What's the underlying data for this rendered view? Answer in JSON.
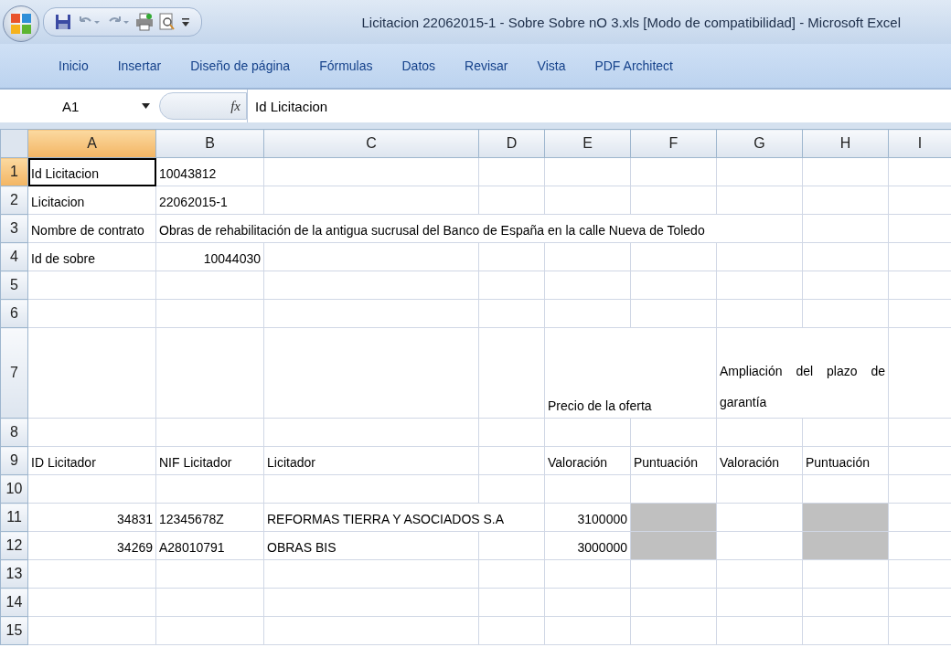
{
  "window": {
    "title": "Licitacion 22062015-1 - Sobre Sobre nO 3.xls  [Modo de compatibilidad] - Microsoft Excel"
  },
  "ribbon_tabs": [
    {
      "label": "Inicio"
    },
    {
      "label": "Insertar"
    },
    {
      "label": "Diseño de página"
    },
    {
      "label": "Fórmulas"
    },
    {
      "label": "Datos"
    },
    {
      "label": "Revisar"
    },
    {
      "label": "Vista"
    },
    {
      "label": "PDF Architect"
    }
  ],
  "formula_bar": {
    "name_box": "A1",
    "function_label": "fx",
    "formula": "Id Licitacion"
  },
  "sheet": {
    "columns": [
      {
        "label": "A",
        "selected": true
      },
      {
        "label": "B",
        "selected": false
      },
      {
        "label": "C",
        "selected": false
      },
      {
        "label": "D",
        "selected": false
      },
      {
        "label": "E",
        "selected": false
      },
      {
        "label": "F",
        "selected": false
      },
      {
        "label": "G",
        "selected": false
      },
      {
        "label": "H",
        "selected": false
      },
      {
        "label": "I",
        "selected": false
      }
    ],
    "rows": [
      {
        "number": "1",
        "selected": true,
        "cells": [
          {
            "kind": "text",
            "text": "Id Licitacion"
          },
          {
            "kind": "text",
            "text": "10043812"
          },
          {
            "kind": "empty"
          },
          {
            "kind": "empty"
          },
          {
            "kind": "empty"
          },
          {
            "kind": "empty"
          },
          {
            "kind": "empty"
          },
          {
            "kind": "empty"
          },
          {
            "kind": "empty"
          }
        ]
      },
      {
        "number": "2",
        "selected": false,
        "cells": [
          {
            "kind": "text",
            "text": "Licitacion"
          },
          {
            "kind": "text",
            "text": "22062015-1"
          },
          {
            "kind": "empty"
          },
          {
            "kind": "empty"
          },
          {
            "kind": "empty"
          },
          {
            "kind": "empty"
          },
          {
            "kind": "empty"
          },
          {
            "kind": "empty"
          },
          {
            "kind": "empty"
          }
        ]
      },
      {
        "number": "3",
        "selected": false,
        "cells": [
          {
            "kind": "text",
            "text": "Nombre de contrato"
          },
          {
            "kind": "text",
            "text": "Obras de rehabilitación de la antigua sucrusal del Banco de España en la calle Nueva de Toledo"
          },
          {
            "kind": "overflow"
          },
          {
            "kind": "overflow"
          },
          {
            "kind": "overflow"
          },
          {
            "kind": "overflow"
          },
          {
            "kind": "overflow"
          },
          {
            "kind": "empty"
          },
          {
            "kind": "empty"
          }
        ]
      },
      {
        "number": "4",
        "selected": false,
        "cells": [
          {
            "kind": "text",
            "text": "Id de sobre"
          },
          {
            "kind": "number",
            "text": "10044030"
          },
          {
            "kind": "empty"
          },
          {
            "kind": "empty"
          },
          {
            "kind": "empty"
          },
          {
            "kind": "empty"
          },
          {
            "kind": "empty"
          },
          {
            "kind": "empty"
          },
          {
            "kind": "empty"
          }
        ]
      },
      {
        "number": "5",
        "selected": false,
        "cells": [
          {
            "kind": "empty"
          },
          {
            "kind": "empty"
          },
          {
            "kind": "empty"
          },
          {
            "kind": "empty"
          },
          {
            "kind": "empty"
          },
          {
            "kind": "empty"
          },
          {
            "kind": "empty"
          },
          {
            "kind": "empty"
          },
          {
            "kind": "empty"
          }
        ]
      },
      {
        "number": "6",
        "selected": false,
        "cells": [
          {
            "kind": "empty"
          },
          {
            "kind": "empty"
          },
          {
            "kind": "empty"
          },
          {
            "kind": "empty"
          },
          {
            "kind": "empty"
          },
          {
            "kind": "empty"
          },
          {
            "kind": "empty"
          },
          {
            "kind": "empty"
          },
          {
            "kind": "empty"
          }
        ]
      },
      {
        "number": "7",
        "selected": false,
        "cells": [
          {
            "kind": "empty"
          },
          {
            "kind": "empty"
          },
          {
            "kind": "empty"
          },
          {
            "kind": "empty"
          },
          {
            "kind": "text",
            "text": "Precio de la oferta"
          },
          {
            "kind": "overflow"
          },
          {
            "kind": "justified",
            "colspan": 2,
            "text": "Ampliación del plazo de garantía"
          },
          {
            "kind": "empty"
          }
        ]
      },
      {
        "number": "8",
        "selected": false,
        "cells": [
          {
            "kind": "empty"
          },
          {
            "kind": "empty"
          },
          {
            "kind": "empty"
          },
          {
            "kind": "empty"
          },
          {
            "kind": "empty"
          },
          {
            "kind": "empty"
          },
          {
            "kind": "empty"
          },
          {
            "kind": "empty"
          },
          {
            "kind": "empty"
          }
        ]
      },
      {
        "number": "9",
        "selected": false,
        "cells": [
          {
            "kind": "text",
            "text": "ID Licitador"
          },
          {
            "kind": "text",
            "text": "NIF Licitador"
          },
          {
            "kind": "text",
            "text": "Licitador"
          },
          {
            "kind": "empty"
          },
          {
            "kind": "text",
            "text": "Valoración"
          },
          {
            "kind": "text",
            "text": "Puntuación"
          },
          {
            "kind": "text",
            "text": "Valoración"
          },
          {
            "kind": "text",
            "text": "Puntuación"
          },
          {
            "kind": "empty"
          }
        ]
      },
      {
        "number": "10",
        "selected": false,
        "cells": [
          {
            "kind": "empty"
          },
          {
            "kind": "empty"
          },
          {
            "kind": "empty"
          },
          {
            "kind": "empty"
          },
          {
            "kind": "empty"
          },
          {
            "kind": "empty"
          },
          {
            "kind": "empty"
          },
          {
            "kind": "empty"
          },
          {
            "kind": "empty"
          }
        ]
      },
      {
        "number": "11",
        "selected": false,
        "cells": [
          {
            "kind": "number",
            "text": "34831"
          },
          {
            "kind": "text",
            "text": "12345678Z"
          },
          {
            "kind": "text",
            "text": "REFORMAS TIERRA Y ASOCIADOS S.A"
          },
          {
            "kind": "overflow"
          },
          {
            "kind": "number",
            "text": "3100000"
          },
          {
            "kind": "shaded"
          },
          {
            "kind": "empty"
          },
          {
            "kind": "shaded"
          },
          {
            "kind": "empty"
          }
        ]
      },
      {
        "number": "12",
        "selected": false,
        "cells": [
          {
            "kind": "number",
            "text": "34269"
          },
          {
            "kind": "text",
            "text": "A28010791"
          },
          {
            "kind": "text",
            "text": "OBRAS BIS"
          },
          {
            "kind": "empty"
          },
          {
            "kind": "number",
            "text": "3000000"
          },
          {
            "kind": "shaded"
          },
          {
            "kind": "empty"
          },
          {
            "kind": "shaded"
          },
          {
            "kind": "empty"
          }
        ]
      },
      {
        "number": "13",
        "selected": false,
        "cells": [
          {
            "kind": "empty"
          },
          {
            "kind": "empty"
          },
          {
            "kind": "empty"
          },
          {
            "kind": "empty"
          },
          {
            "kind": "empty"
          },
          {
            "kind": "empty"
          },
          {
            "kind": "empty"
          },
          {
            "kind": "empty"
          },
          {
            "kind": "empty"
          }
        ]
      },
      {
        "number": "14",
        "selected": false,
        "cells": [
          {
            "kind": "empty"
          },
          {
            "kind": "empty"
          },
          {
            "kind": "empty"
          },
          {
            "kind": "empty"
          },
          {
            "kind": "empty"
          },
          {
            "kind": "empty"
          },
          {
            "kind": "empty"
          },
          {
            "kind": "empty"
          },
          {
            "kind": "empty"
          }
        ]
      },
      {
        "number": "15",
        "selected": false,
        "cells": [
          {
            "kind": "empty"
          },
          {
            "kind": "empty"
          },
          {
            "kind": "empty"
          },
          {
            "kind": "empty"
          },
          {
            "kind": "empty"
          },
          {
            "kind": "empty"
          },
          {
            "kind": "empty"
          },
          {
            "kind": "empty"
          },
          {
            "kind": "empty"
          }
        ]
      }
    ]
  }
}
